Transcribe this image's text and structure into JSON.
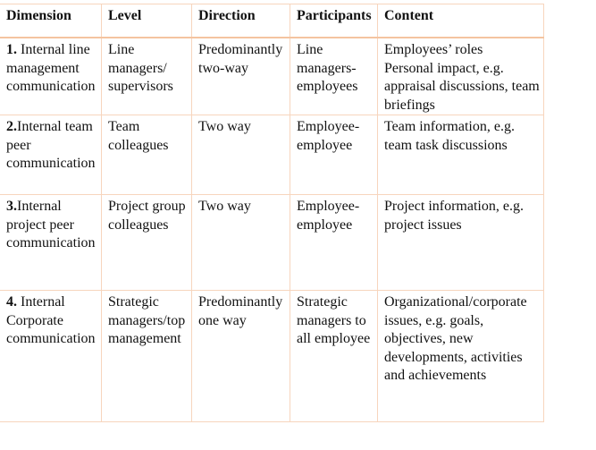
{
  "table": {
    "headers": [
      "Dimension",
      "Level",
      "Direction",
      "Participants",
      "Content"
    ],
    "rows": [
      {
        "dimension_num": "1.",
        "dimension_text": " Internal line management communication",
        "level": "Line managers/ supervisors",
        "direction": "Predominantly two-way",
        "participants": "Line managers-employees",
        "content_lines": [
          "Employees’ roles",
          "Personal impact, e.g. appraisal discussions, team briefings"
        ]
      },
      {
        "dimension_num": "2.",
        "dimension_text": "Internal team peer communication",
        "level": "Team colleagues",
        "direction": "Two way",
        "participants": "Employee-employee",
        "content_lines": [
          "Team information, e.g. team task discussions"
        ]
      },
      {
        "dimension_num": "3.",
        "dimension_text": "Internal project peer communication",
        "level": "Project group colleagues",
        "direction": "Two way",
        "participants": "Employee-employee",
        "content_lines": [
          "Project information, e.g. project issues"
        ]
      },
      {
        "dimension_num": "4.",
        "dimension_text": " Internal Corporate communication",
        "level": "Strategic managers/top management",
        "direction": "Predominantly one way",
        "participants": "Strategic managers to all employee",
        "content_lines": [
          "Organizational/corporate issues, e.g. goals, objectives, new developments, activities and achievements"
        ]
      }
    ]
  },
  "colors": {
    "border": "#f7d5bd",
    "header_border": "#f4c4a0",
    "text": "#111111"
  }
}
